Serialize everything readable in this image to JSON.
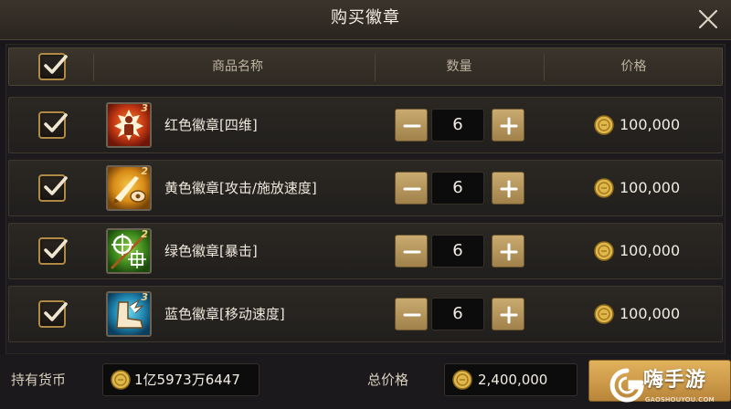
{
  "dialog": {
    "title": "购买徽章"
  },
  "table": {
    "headers": {
      "name": "商品名称",
      "quantity": "数量",
      "price": "价格"
    },
    "select_all_checked": true
  },
  "items": [
    {
      "name": "红色徽章[四维]",
      "level": "3",
      "quantity": "6",
      "price": "100,000",
      "checked": true,
      "icon": "red-badge-icon"
    },
    {
      "name": "黄色徽章[攻击/施放速度]",
      "level": "2",
      "quantity": "6",
      "price": "100,000",
      "checked": true,
      "icon": "yellow-badge-icon"
    },
    {
      "name": "绿色徽章[暴击]",
      "level": "2",
      "quantity": "6",
      "price": "100,000",
      "checked": true,
      "icon": "green-badge-icon"
    },
    {
      "name": "蓝色徽章[移动速度]",
      "level": "3",
      "quantity": "6",
      "price": "100,000",
      "checked": true,
      "icon": "blue-badge-icon"
    }
  ],
  "footer": {
    "held_currency_label": "持有货币",
    "held_currency_value": "1亿5973万6447",
    "total_label": "总价格",
    "total_value": "2,400,000"
  },
  "watermark": {
    "text": "嗨手游",
    "url": "GAOSHOUYOU.COM"
  },
  "colors": {
    "accent_gold": "#c9ab70",
    "coin": "#e0b84a",
    "buy_button": "#e2b25c"
  }
}
